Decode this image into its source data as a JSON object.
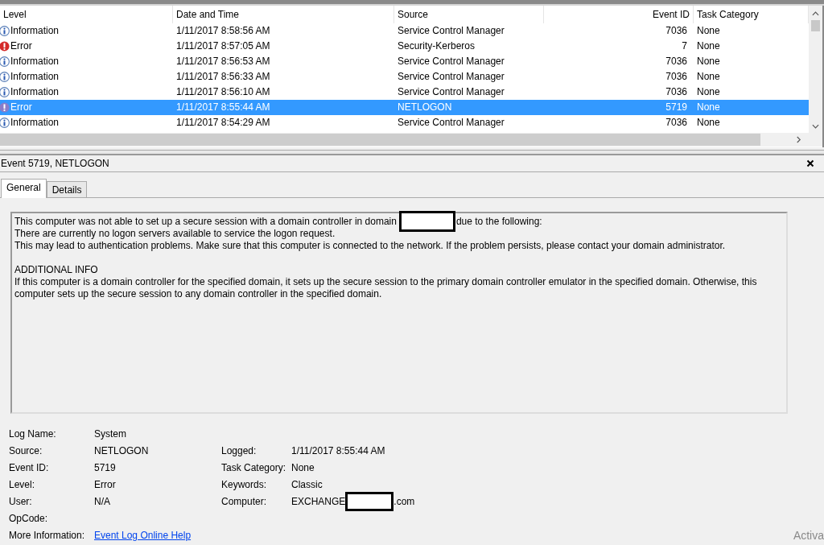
{
  "table": {
    "columns": [
      {
        "label": "Level"
      },
      {
        "label": "Date and Time"
      },
      {
        "label": "Source"
      },
      {
        "label": "Event ID"
      },
      {
        "label": "Task Category"
      }
    ],
    "rows": [
      {
        "level": "Information",
        "kind": "info",
        "date": "1/11/2017 8:58:56 AM",
        "source": "Service Control Manager",
        "event_id": "7036",
        "task": "None",
        "selected": false
      },
      {
        "level": "Error",
        "kind": "error",
        "date": "1/11/2017 8:57:05 AM",
        "source": "Security-Kerberos",
        "event_id": "7",
        "task": "None",
        "selected": false
      },
      {
        "level": "Information",
        "kind": "info",
        "date": "1/11/2017 8:56:53 AM",
        "source": "Service Control Manager",
        "event_id": "7036",
        "task": "None",
        "selected": false
      },
      {
        "level": "Information",
        "kind": "info",
        "date": "1/11/2017 8:56:33 AM",
        "source": "Service Control Manager",
        "event_id": "7036",
        "task": "None",
        "selected": false
      },
      {
        "level": "Information",
        "kind": "info",
        "date": "1/11/2017 8:56:10 AM",
        "source": "Service Control Manager",
        "event_id": "7036",
        "task": "None",
        "selected": false
      },
      {
        "level": "Error",
        "kind": "error",
        "date": "1/11/2017 8:55:44 AM",
        "source": "NETLOGON",
        "event_id": "5719",
        "task": "None",
        "selected": true
      },
      {
        "level": "Information",
        "kind": "info",
        "date": "1/11/2017 8:54:29 AM",
        "source": "Service Control Manager",
        "event_id": "7036",
        "task": "None",
        "selected": false
      }
    ]
  },
  "detail": {
    "title": "Event 5719, NETLOGON",
    "tabs": [
      {
        "label": "General",
        "selected": true
      },
      {
        "label": "Details",
        "selected": false
      }
    ],
    "message": [
      [
        [
          {
            "kind": "text",
            "text": "This computer was not able to set up a secure session with a domain controller in domain"
          },
          {
            "kind": "redaction"
          },
          {
            "kind": "text",
            "text": "due to the following:"
          }
        ],
        [
          {
            "kind": "text",
            "text": "There are currently no logon servers available to service the logon request."
          }
        ],
        [
          {
            "kind": "text",
            "text": "This may lead to authentication problems. Make sure that this computer is connected to the network. If the problem persists, please contact your domain administrator."
          }
        ]
      ],
      [
        [
          {
            "kind": "text",
            "text": "ADDITIONAL INFO"
          }
        ],
        [
          {
            "kind": "text",
            "text": "If this computer is a domain controller for the specified domain, it sets up the secure session to the primary domain controller emulator in the specified domain. Otherwise, this computer sets up the secure session to any domain controller in the specified domain."
          }
        ]
      ]
    ],
    "fields_left": [
      {
        "label": "Log Name:",
        "value": [
          {
            "kind": "text",
            "text": "System"
          }
        ]
      },
      {
        "label": "Source:",
        "value": [
          {
            "kind": "text",
            "text": "NETLOGON"
          }
        ]
      },
      {
        "label": "Event ID:",
        "value": [
          {
            "kind": "text",
            "text": "5719"
          }
        ]
      },
      {
        "label": "Level:",
        "value": [
          {
            "kind": "text",
            "text": "Error"
          }
        ]
      },
      {
        "label": "User:",
        "value": [
          {
            "kind": "text",
            "text": "N/A"
          }
        ]
      },
      {
        "label": "OpCode:"
      },
      {
        "label": "More Information:",
        "value": [
          {
            "kind": "link",
            "text": "Event Log Online Help"
          }
        ]
      }
    ],
    "fields_right": [
      {
        "label": "Logged:",
        "value": [
          {
            "kind": "text",
            "text": "1/11/2017 8:55:44 AM"
          }
        ]
      },
      {
        "label": "Task Category:",
        "value": [
          {
            "kind": "text",
            "text": "None"
          }
        ]
      },
      {
        "label": "Keywords:",
        "value": [
          {
            "kind": "text",
            "text": "Classic"
          }
        ]
      },
      {
        "label": "Computer:",
        "value": [
          {
            "kind": "text",
            "text": "EXCHANGE"
          },
          {
            "kind": "redaction"
          },
          {
            "kind": "text",
            "text": ".com"
          }
        ]
      }
    ]
  },
  "activation_notice": "Activa"
}
